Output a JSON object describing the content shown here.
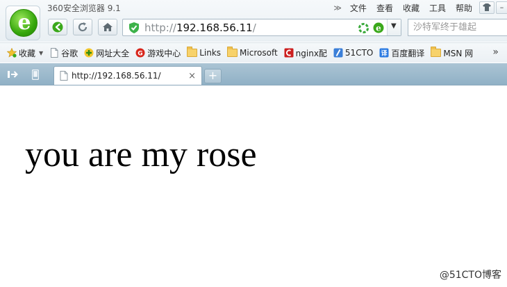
{
  "window": {
    "app_title": "360安全浏览器 9.1",
    "menu_chevrons": "≫",
    "menu": [
      "文件",
      "查看",
      "收藏",
      "工具",
      "帮助"
    ],
    "controls": [
      "shirt-icon",
      "minimize-icon"
    ]
  },
  "toolbar": {
    "back_icon": "arrow-left-icon",
    "refresh_icon": "refresh-icon",
    "home_icon": "home-icon"
  },
  "address": {
    "scheme": "http://",
    "host": "192.168.56.11",
    "path": "/"
  },
  "search": {
    "placeholder": "沙特军终于雄起"
  },
  "bookmarks": {
    "favorites_label": "收藏",
    "items": [
      {
        "label": "谷歌",
        "icon": "page-icon"
      },
      {
        "label": "网址大全",
        "icon": "360-site-icon"
      },
      {
        "label": "游戏中心",
        "icon": "game-icon"
      },
      {
        "label": "Links",
        "icon": "folder-icon"
      },
      {
        "label": "Microsoft",
        "icon": "folder-icon"
      },
      {
        "label": "nginx配",
        "icon": "nginx-icon"
      },
      {
        "label": "51CTO",
        "icon": "51cto-icon"
      },
      {
        "label": "百度翻译",
        "icon": "translate-icon"
      },
      {
        "label": "MSN 网",
        "icon": "folder-icon"
      }
    ],
    "more": "»"
  },
  "tabs": [
    {
      "title": "http://192.168.56.11/",
      "close": "×"
    }
  ],
  "new_tab": "+",
  "page": {
    "headline": "you are my rose"
  },
  "watermark": "@51CTO博客",
  "colors": {
    "accent_green": "#36a70c",
    "tab_strip": "#9fbccf",
    "url_gray": "#8a8f93"
  }
}
